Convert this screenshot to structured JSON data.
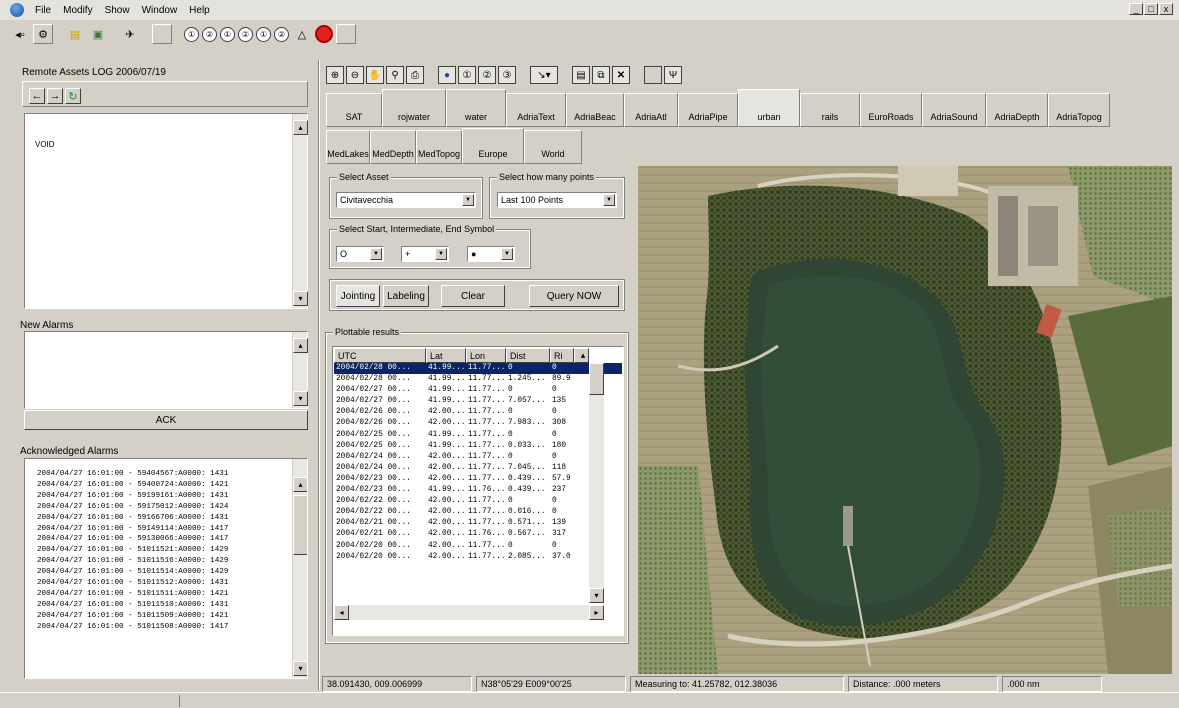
{
  "menubar": {
    "items": [
      "File",
      "Modify",
      "Show",
      "Window",
      "Help"
    ],
    "window_controls": [
      "_",
      "□",
      "x"
    ]
  },
  "toolbar": {
    "numbered_buttons": [
      "①",
      "②",
      "①",
      "②",
      "①",
      "②"
    ]
  },
  "left": {
    "remote_log_title": "Remote Assets LOG  2006/07/19",
    "void_text": "VOID",
    "new_alarms_title": "New Alarms",
    "ack_button": "ACK",
    "acknowledged_title": "Acknowledged Alarms",
    "acknowledged_alarms": [
      "2004/04/27 16:01:00 - 59404567:A0000: 1431",
      "2004/04/27 16:01:00 - 59400724:A0000: 1421",
      "2004/04/27 16:01:00 - 59199161:A0000: 1431",
      "2004/04/27 16:01:00 - 59175012:A0000: 1424",
      "2004/04/27 16:01:00 - 59166706:A0000: 1431",
      "2004/04/27 16:01:00 - 59149114:A0000: 1417",
      "2004/04/27 16:01:00 - 59130066:A0000: 1417",
      "2004/04/27 16:01:00 - 51011521:A0000: 1429",
      "2004/04/27 16:01:00 - 51011516:A0000: 1429",
      "2004/04/27 16:01:00 - 51011514:A0000: 1429",
      "2004/04/27 16:01:00 - 51011512:A0000: 1431",
      "2004/04/27 16:01:00 - 51011511:A0000: 1421",
      "2004/04/27 16:01:00 - 51011510:A0000: 1431",
      "2004/04/27 16:01:00 - 51011509:A0000: 1421",
      "2004/04/27 16:01:00 - 51011508:A0000: 1417"
    ]
  },
  "layers": {
    "row1": [
      "SAT",
      "rojwater",
      "water",
      "AdriaText",
      "AdriaBeac",
      "AdriaAtl",
      "AdriaPipe",
      "urban",
      "rails",
      "EuroRoads",
      "AdriaSound",
      "AdriaDepth",
      "AdriaTopog"
    ],
    "row2": [
      "MedLakes",
      "MedDepth",
      "MedTopog",
      "Europe",
      "World"
    ]
  },
  "query": {
    "select_asset_label": "Select Asset",
    "asset_value": "Civitavecchia",
    "select_points_label": "Select how many points",
    "points_value": "Last 100 Points",
    "symbol_label": "Select Start, Intermediate, End Symbol",
    "symbol_start": "O",
    "symbol_mid": "+",
    "symbol_end": "●",
    "jointing_button": "Jointing",
    "labeling_button": "Labeling",
    "clear_button": "Clear",
    "query_button": "Query NOW",
    "plottable_label": "Plottable results"
  },
  "results": {
    "columns": [
      "UTC",
      "Lat",
      "Lon",
      "Dist",
      "Ri"
    ],
    "rows": [
      [
        "2004/02/28 00...",
        "41.99...",
        "11.77...",
        "0",
        "0"
      ],
      [
        "2004/02/28 00...",
        "41.99...",
        "11.77...",
        "1.245...",
        "89.9"
      ],
      [
        "2004/02/27 00...",
        "41.99...",
        "11.77...",
        "0",
        "0"
      ],
      [
        "2004/02/27 00...",
        "41.99...",
        "11.77...",
        "7.057...",
        "135"
      ],
      [
        "2004/02/26 00...",
        "42.00...",
        "11.77...",
        "0",
        "0"
      ],
      [
        "2004/02/26 00...",
        "42.00...",
        "11.77...",
        "7.983...",
        "308"
      ],
      [
        "2004/02/25 00...",
        "41.99...",
        "11.77...",
        "0",
        "0"
      ],
      [
        "2004/02/25 00...",
        "41.99...",
        "11.77...",
        "0.033...",
        "180"
      ],
      [
        "2004/02/24 00...",
        "42.00...",
        "11.77...",
        "0",
        "0"
      ],
      [
        "2004/02/24 00...",
        "42.00...",
        "11.77...",
        "7.045...",
        "118"
      ],
      [
        "2004/02/23 00...",
        "42.00...",
        "11.77...",
        "0.439...",
        "57.9"
      ],
      [
        "2004/02/23 00...",
        "41.99...",
        "11.76...",
        "0.439...",
        "237"
      ],
      [
        "2004/02/22 00...",
        "42.00...",
        "11.77...",
        "0",
        "0"
      ],
      [
        "2004/02/22 00...",
        "42.00...",
        "11.77...",
        "0.016...",
        "0"
      ],
      [
        "2004/02/21 00...",
        "42.00...",
        "11.77...",
        "0.571...",
        "139"
      ],
      [
        "2004/02/21 00...",
        "42.00...",
        "11.76...",
        "0.567...",
        "317"
      ],
      [
        "2004/02/20 00...",
        "42.00...",
        "11.77...",
        "0",
        "0"
      ],
      [
        "2004/02/20 00...",
        "42.00...",
        "11.77...",
        "2.085...",
        "37.0"
      ]
    ]
  },
  "status": {
    "coords": "38.091430, 009.006999",
    "dms": "N38°05'29  E009°00'25",
    "measuring": "Measuring to: 41.25782, 012.38036",
    "distance": "Distance: .000 meters",
    "nm": ".000 nm"
  }
}
